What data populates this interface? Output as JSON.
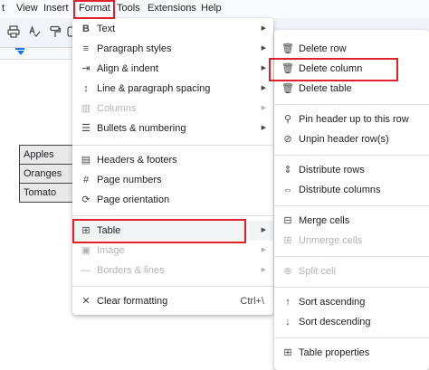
{
  "menubar": {
    "items": [
      "t",
      "View",
      "Insert",
      "Format",
      "Tools",
      "Extensions",
      "Help"
    ]
  },
  "table_cells": [
    "Apples",
    "Oranges",
    "Tomato"
  ],
  "format_menu": {
    "items": [
      {
        "label": "Text",
        "icon": "bold-icon",
        "submenu": true,
        "disabled": false
      },
      {
        "label": "Paragraph styles",
        "icon": "paragraph-styles-icon",
        "submenu": true,
        "disabled": false
      },
      {
        "label": "Align & indent",
        "icon": "align-indent-icon",
        "submenu": true,
        "disabled": false
      },
      {
        "label": "Line & paragraph spacing",
        "icon": "line-spacing-icon",
        "submenu": true,
        "disabled": false
      },
      {
        "label": "Columns",
        "icon": "columns-icon",
        "submenu": true,
        "disabled": true
      },
      {
        "label": "Bullets & numbering",
        "icon": "bullets-icon",
        "submenu": true,
        "disabled": false
      },
      {
        "label": "Headers & footers",
        "icon": "headers-footers-icon",
        "submenu": false,
        "disabled": false
      },
      {
        "label": "Page numbers",
        "icon": "page-numbers-icon",
        "submenu": false,
        "disabled": false
      },
      {
        "label": "Page orientation",
        "icon": "page-orientation-icon",
        "submenu": false,
        "disabled": false
      },
      {
        "label": "Table",
        "icon": "table-icon",
        "submenu": true,
        "disabled": false
      },
      {
        "label": "Image",
        "icon": "image-icon",
        "submenu": true,
        "disabled": true
      },
      {
        "label": "Borders & lines",
        "icon": "borders-lines-icon",
        "submenu": true,
        "disabled": true
      },
      {
        "label": "Clear formatting",
        "icon": "clear-formatting-icon",
        "shortcut": "Ctrl+\\",
        "submenu": false,
        "disabled": false
      }
    ]
  },
  "table_submenu": {
    "items": [
      {
        "label": "Delete row",
        "icon": "trash-icon",
        "disabled": false
      },
      {
        "label": "Delete column",
        "icon": "trash-icon",
        "disabled": false
      },
      {
        "label": "Delete table",
        "icon": "trash-icon",
        "disabled": false
      },
      {
        "label": "Pin header up to this row",
        "icon": "pin-icon",
        "disabled": false
      },
      {
        "label": "Unpin header row(s)",
        "icon": "unpin-icon",
        "disabled": false
      },
      {
        "label": "Distribute rows",
        "icon": "distribute-rows-icon",
        "disabled": false
      },
      {
        "label": "Distribute columns",
        "icon": "distribute-columns-icon",
        "disabled": false
      },
      {
        "label": "Merge cells",
        "icon": "merge-cells-icon",
        "disabled": false
      },
      {
        "label": "Unmerge cells",
        "icon": "unmerge-cells-icon",
        "disabled": true
      },
      {
        "label": "Split cell",
        "icon": "split-cell-icon",
        "disabled": true
      },
      {
        "label": "Sort ascending",
        "icon": "sort-ascending-icon",
        "disabled": false
      },
      {
        "label": "Sort descending",
        "icon": "sort-descending-icon",
        "disabled": false
      },
      {
        "label": "Table properties",
        "icon": "table-properties-icon",
        "disabled": false
      }
    ]
  },
  "colors": {
    "highlight_box": "#e0202c",
    "accent": "#1a73e8"
  }
}
